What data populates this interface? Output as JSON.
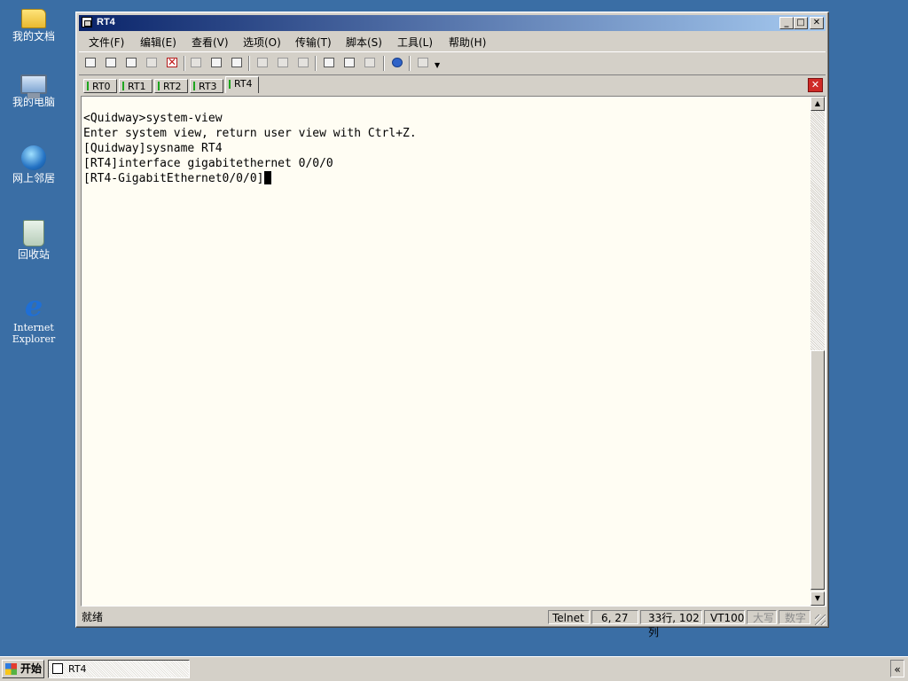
{
  "desktop": {
    "icons": [
      {
        "label": "我的文档",
        "icon": "folder-icon"
      },
      {
        "label": "我的电脑",
        "icon": "computer-icon"
      },
      {
        "label": "网上邻居",
        "icon": "network-icon"
      },
      {
        "label": "回收站",
        "icon": "recycle-bin-icon"
      },
      {
        "label": "Internet Explorer",
        "icon": "internet-explorer-icon"
      }
    ]
  },
  "window": {
    "title": "RT4",
    "controls": {
      "minimize": "_",
      "maximize": "□",
      "close": "✕"
    },
    "menu": [
      "文件(F)",
      "编辑(E)",
      "查看(V)",
      "选项(O)",
      "传输(T)",
      "脚本(S)",
      "工具(L)",
      "帮助(H)"
    ],
    "toolbar_icons": [
      "new-session-icon",
      "connect-icon",
      "duplicate-icon",
      "disconnect-icon",
      "close-session-icon",
      "copy-icon",
      "paste-icon",
      "find-icon",
      "print-icon",
      "print-screen-icon",
      "print-setup-icon",
      "properties-icon",
      "settings-icon",
      "key-icon",
      "help-icon",
      "toolbar-options-icon"
    ],
    "tabs": [
      "RT0",
      "RT1",
      "RT2",
      "RT3",
      "RT4"
    ],
    "active_tab": "RT4",
    "tab_close": "✕",
    "terminal": {
      "lines": [
        "<Quidway>system-view",
        "Enter system view, return user view with Ctrl+Z.",
        "[Quidway]sysname RT4",
        "[RT4]interface gigabitethernet 0/0/0",
        "[RT4-GigabitEthernet0/0/0]"
      ]
    },
    "status": {
      "ready": "就绪",
      "protocol": "Telnet",
      "cursor_pos": "6,  27",
      "size": "33行, 102列",
      "emulation": "VT100",
      "caps": "大写",
      "num": "数字"
    }
  },
  "taskbar": {
    "start_label": "开始",
    "tasks": [
      "RT4"
    ],
    "tray_chevron": "«"
  }
}
